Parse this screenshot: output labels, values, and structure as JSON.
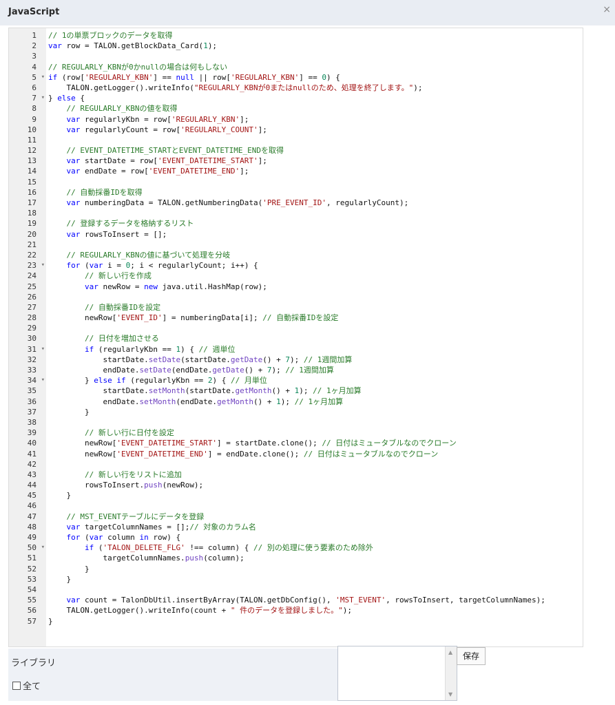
{
  "window": {
    "title": "JavaScript",
    "close_icon": "×"
  },
  "editor": {
    "lines": [
      {
        "n": "1",
        "c": "// 1の単票ブロックのデータを取得"
      },
      {
        "n": "2",
        "c": "var row = TALON.getBlockData_Card(1);"
      },
      {
        "n": "3",
        "c": ""
      },
      {
        "n": "4",
        "c": "// REGULARLY_KBNが0かnullの場合は何もしない"
      },
      {
        "n": "5",
        "c": "if (row['REGULARLY_KBN'] == null || row['REGULARLY_KBN'] == 0) {"
      },
      {
        "n": "6",
        "c": "    TALON.getLogger().writeInfo(\"REGULARLY_KBNが0またはnullのため、処理を終了します。\");"
      },
      {
        "n": "7",
        "c": "} else {"
      },
      {
        "n": "8",
        "c": "    // REGULARLY_KBNの値を取得"
      },
      {
        "n": "9",
        "c": "    var regularlyKbn = row['REGULARLY_KBN'];"
      },
      {
        "n": "10",
        "c": "    var regularlyCount = row['REGULARLY_COUNT'];"
      },
      {
        "n": "11",
        "c": ""
      },
      {
        "n": "12",
        "c": "    // EVENT_DATETIME_STARTとEVENT_DATETIME_ENDを取得"
      },
      {
        "n": "13",
        "c": "    var startDate = row['EVENT_DATETIME_START'];"
      },
      {
        "n": "14",
        "c": "    var endDate = row['EVENT_DATETIME_END'];"
      },
      {
        "n": "15",
        "c": ""
      },
      {
        "n": "16",
        "c": "    // 自動採番IDを取得"
      },
      {
        "n": "17",
        "c": "    var numberingData = TALON.getNumberingData('PRE_EVENT_ID', regularlyCount);"
      },
      {
        "n": "18",
        "c": ""
      },
      {
        "n": "19",
        "c": "    // 登録するデータを格納するリスト"
      },
      {
        "n": "20",
        "c": "    var rowsToInsert = [];"
      },
      {
        "n": "21",
        "c": ""
      },
      {
        "n": "22",
        "c": "    // REGULARLY_KBNの値に基づいて処理を分岐"
      },
      {
        "n": "23",
        "c": "    for (var i = 0; i < regularlyCount; i++) {"
      },
      {
        "n": "24",
        "c": "        // 新しい行を作成"
      },
      {
        "n": "25",
        "c": "        var newRow = new java.util.HashMap(row);"
      },
      {
        "n": "26",
        "c": ""
      },
      {
        "n": "27",
        "c": "        // 自動採番IDを設定"
      },
      {
        "n": "28",
        "c": "        newRow['EVENT_ID'] = numberingData[i]; // 自動採番IDを設定"
      },
      {
        "n": "29",
        "c": ""
      },
      {
        "n": "30",
        "c": "        // 日付を増加させる"
      },
      {
        "n": "31",
        "c": "        if (regularlyKbn == 1) { // 週単位"
      },
      {
        "n": "32",
        "c": "            startDate.setDate(startDate.getDate() + 7); // 1週間加算"
      },
      {
        "n": "33",
        "c": "            endDate.setDate(endDate.getDate() + 7); // 1週間加算"
      },
      {
        "n": "34",
        "c": "        } else if (regularlyKbn == 2) { // 月単位"
      },
      {
        "n": "35",
        "c": "            startDate.setMonth(startDate.getMonth() + 1); // 1ヶ月加算"
      },
      {
        "n": "36",
        "c": "            endDate.setMonth(endDate.getMonth() + 1); // 1ヶ月加算"
      },
      {
        "n": "37",
        "c": "        }"
      },
      {
        "n": "38",
        "c": ""
      },
      {
        "n": "39",
        "c": "        // 新しい行に日付を設定"
      },
      {
        "n": "40",
        "c": "        newRow['EVENT_DATETIME_START'] = startDate.clone(); // 日付はミュータブルなのでクローン"
      },
      {
        "n": "41",
        "c": "        newRow['EVENT_DATETIME_END'] = endDate.clone(); // 日付はミュータブルなのでクローン"
      },
      {
        "n": "42",
        "c": ""
      },
      {
        "n": "43",
        "c": "        // 新しい行をリストに追加"
      },
      {
        "n": "44",
        "c": "        rowsToInsert.push(newRow);"
      },
      {
        "n": "45",
        "c": "    }"
      },
      {
        "n": "46",
        "c": ""
      },
      {
        "n": "47",
        "c": "    // MST_EVENTテーブルにデータを登録"
      },
      {
        "n": "48",
        "c": "    var targetColumnNames = [];// 対象のカラム名"
      },
      {
        "n": "49",
        "c": "    for (var column in row) {"
      },
      {
        "n": "50",
        "c": "        if ('TALON_DELETE_FLG' !== column) { // 別の処理に使う要素のため除外"
      },
      {
        "n": "51",
        "c": "            targetColumnNames.push(column);"
      },
      {
        "n": "52",
        "c": "        }"
      },
      {
        "n": "53",
        "c": "    }"
      },
      {
        "n": "54",
        "c": ""
      },
      {
        "n": "55",
        "c": "    var count = TalonDbUtil.insertByArray(TALON.getDbConfig(), 'MST_EVENT', rowsToInsert, targetColumnNames);"
      },
      {
        "n": "56",
        "c": "    TALON.getLogger().writeInfo(count + \" 件のデータを登録しました。\");"
      },
      {
        "n": "57",
        "c": "}"
      }
    ],
    "fold_lines": [
      "5",
      "7",
      "23",
      "31",
      "34",
      "50"
    ]
  },
  "library": {
    "label": "ライブラリ",
    "all_checkbox_label": "全て"
  },
  "save_button": {
    "label": "保存"
  }
}
